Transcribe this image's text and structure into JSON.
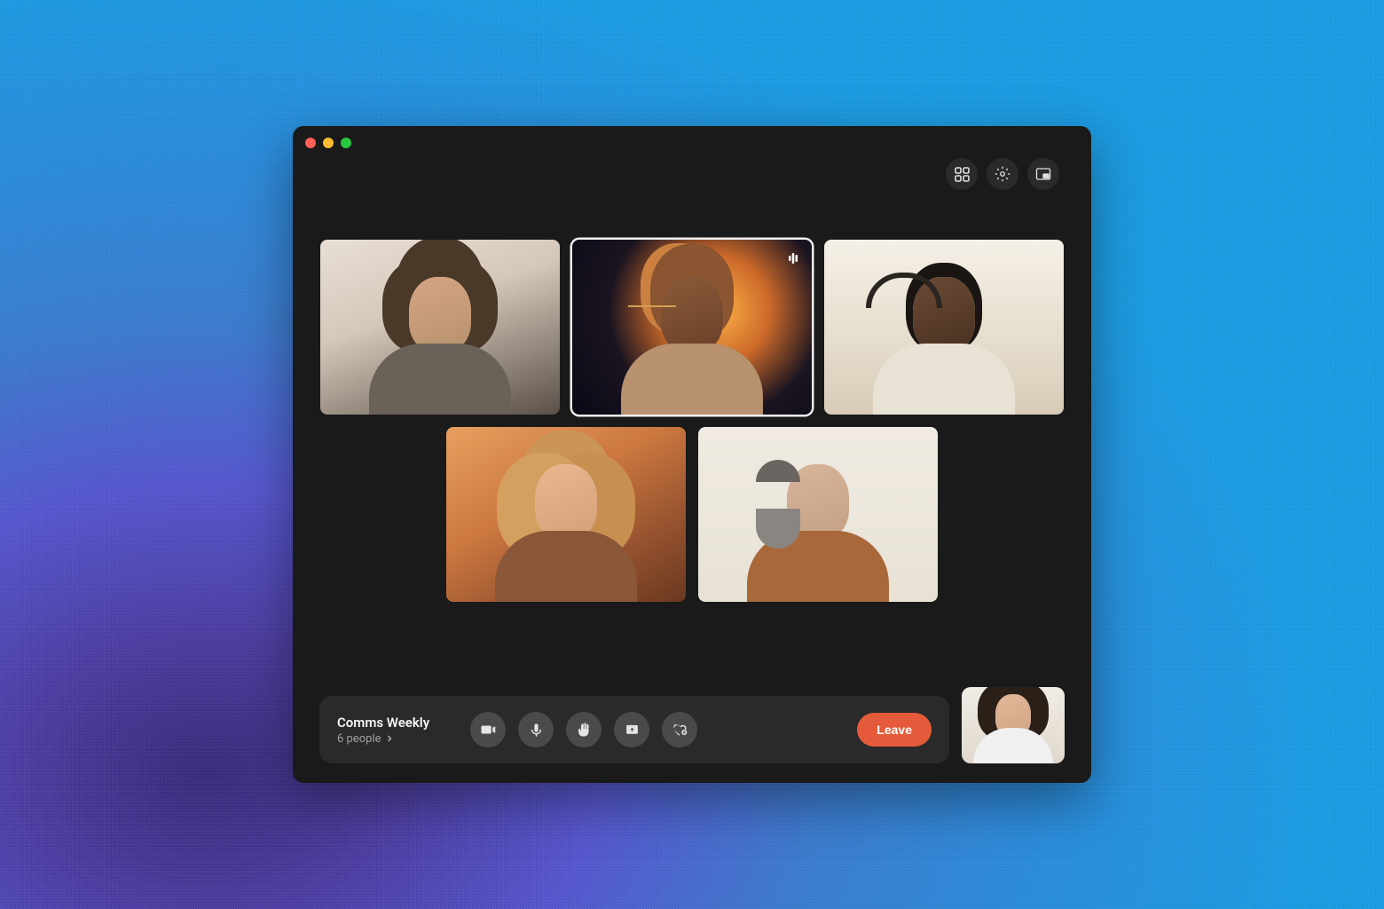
{
  "meeting": {
    "title": "Comms Weekly",
    "people_count_label": "6 people"
  },
  "controls": {
    "leave_label": "Leave"
  },
  "header_icons": {
    "layout": "layout-grid-icon",
    "settings": "gear-icon",
    "pip": "pip-icon"
  },
  "control_icons": {
    "camera": "camera-icon",
    "mic": "microphone-icon",
    "hand": "raise-hand-icon",
    "share": "share-screen-icon",
    "react": "reaction-icon"
  },
  "participants": [
    {
      "slot": 1,
      "speaking": false
    },
    {
      "slot": 2,
      "speaking": true
    },
    {
      "slot": 3,
      "speaking": false
    },
    {
      "slot": 4,
      "speaking": false
    },
    {
      "slot": 5,
      "speaking": false
    }
  ],
  "colors": {
    "accent": "#e55a3a",
    "window_bg": "#1a1a1a",
    "bar_bg": "#2a2a2a"
  }
}
